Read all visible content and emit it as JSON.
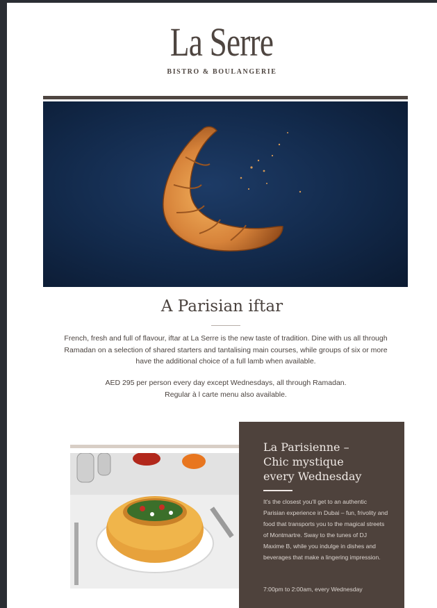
{
  "header": {
    "logo_main": "La Serre",
    "logo_sub": "BISTRO & BOULANGERIE"
  },
  "hero": {
    "image": "croissant-crescent-image"
  },
  "iftar": {
    "title": "A Parisian iftar",
    "body": "French, fresh and full of flavour, iftar at La Serre is the new taste of tradition. Dine with us all through Ramadan on a selection of shared starters and tantalising main courses, while groups of six or more have the additional choice of a full lamb when available.",
    "price_line1": "AED 295 per person every day except Wednesdays, all through Ramadan.",
    "price_line2": "Regular à l carte menu also available."
  },
  "wednesday": {
    "image": "dish-photo",
    "title_line1": "La Parisienne –",
    "title_line2": "Chic mystique",
    "title_line3": "every Wednesday",
    "body": "It's the closest you'll get to an authentic Parisian experience in Dubai – fun, frivolity and food that transports you to the magical streets of Montmartre. Sway to the tunes of DJ Maxime B, while you indulge in dishes and beverages that make a lingering impression.",
    "time": "7:00pm to 2:00am, every Wednesday"
  },
  "colors": {
    "brand_brown": "#4e4540",
    "panel_bg": "#4e423c",
    "hero_blue": "#12294a"
  }
}
